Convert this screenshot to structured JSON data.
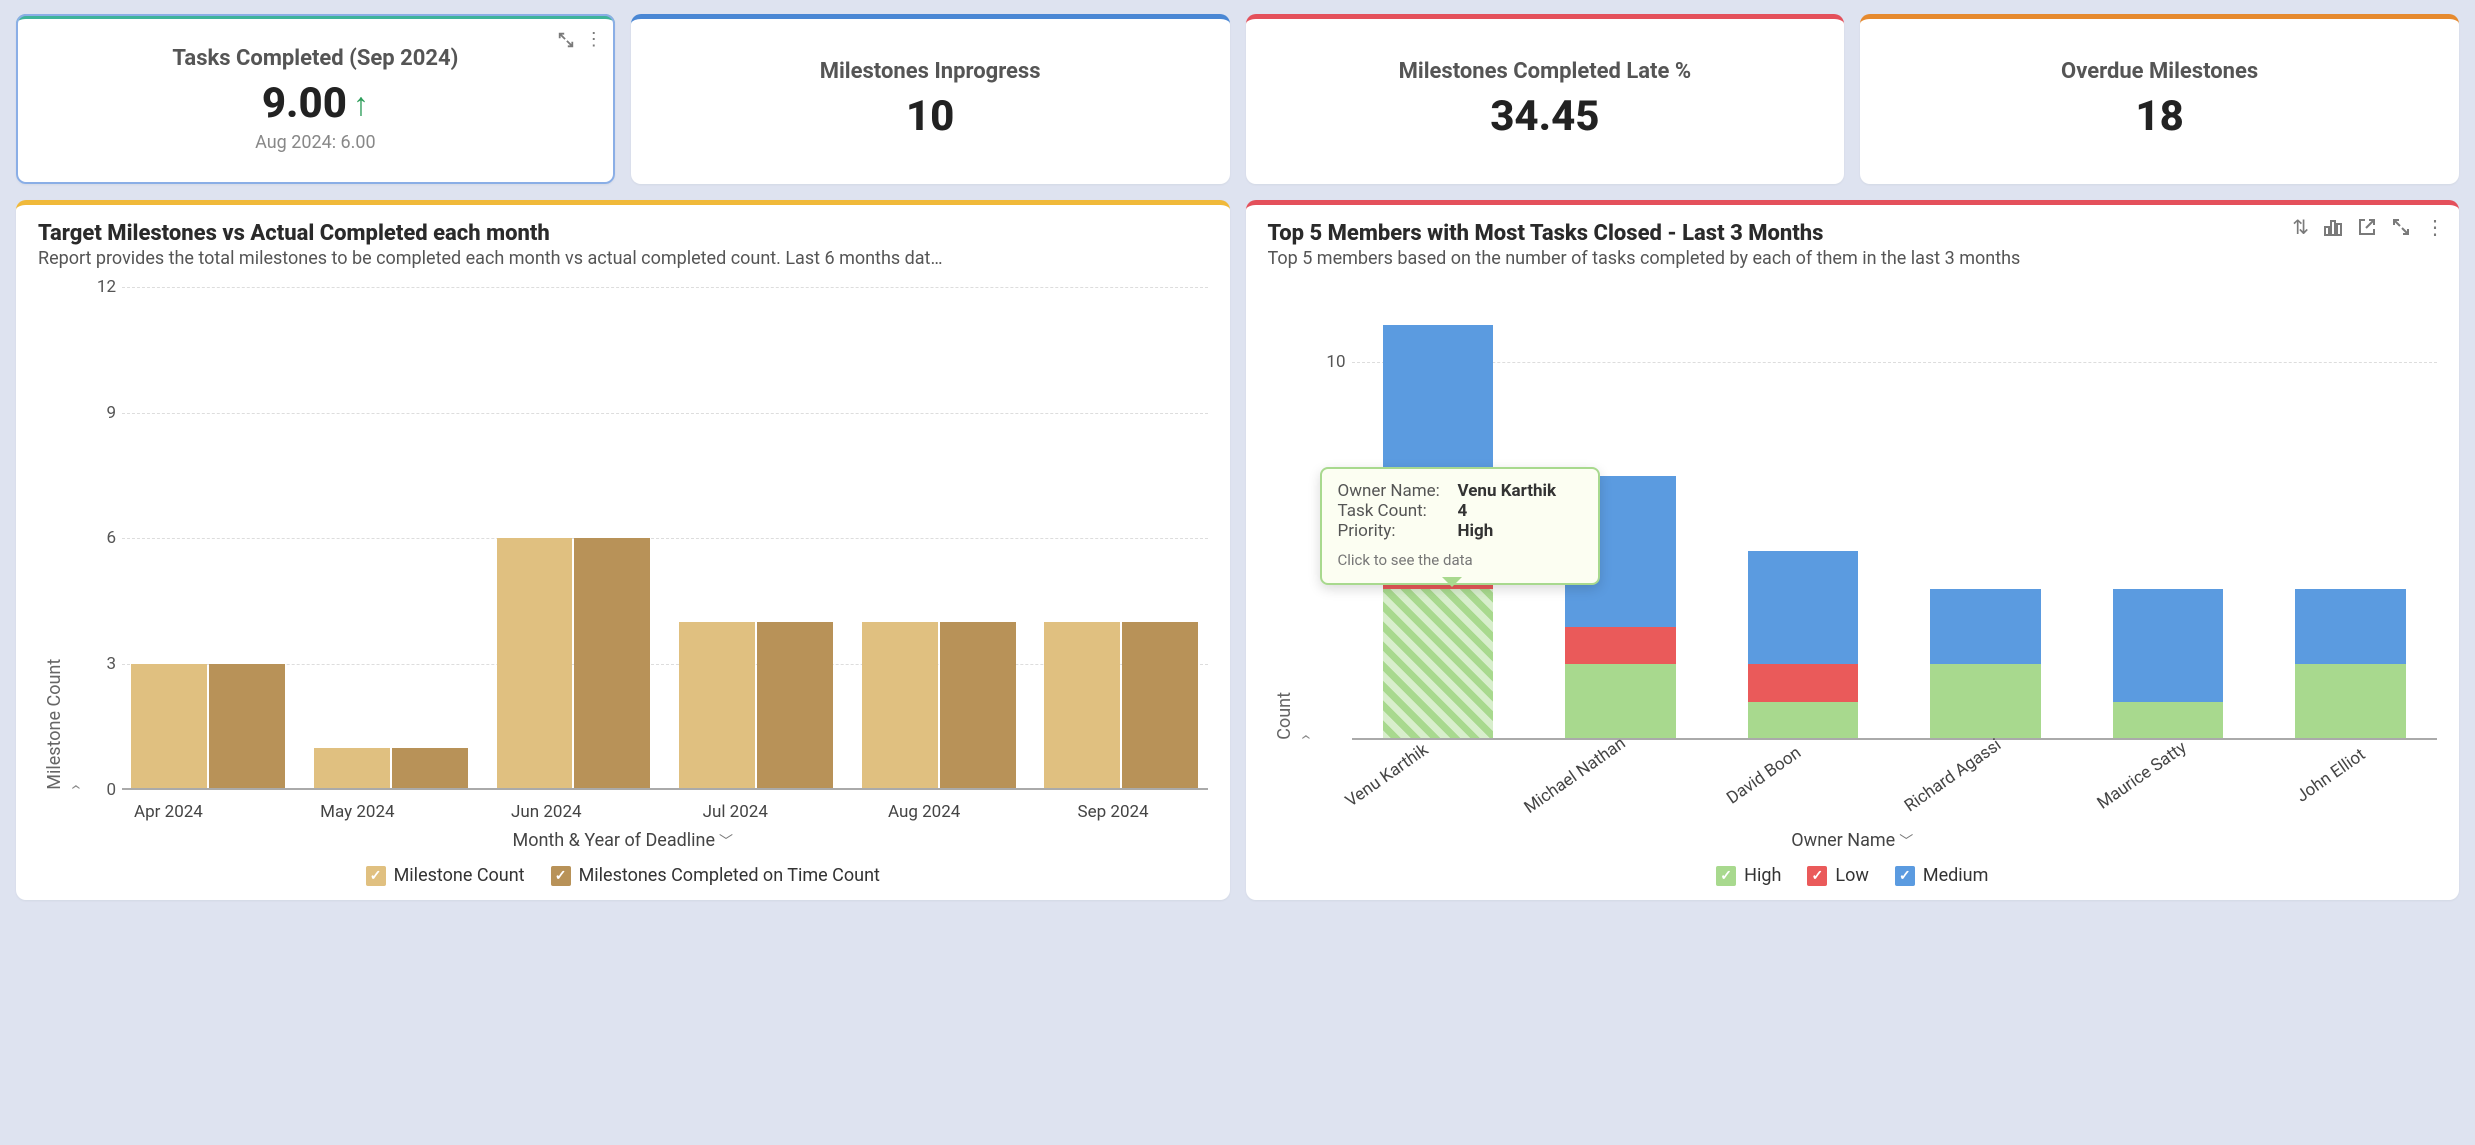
{
  "kpis": [
    {
      "title": "Tasks Completed (Sep 2024)",
      "value": "9.00",
      "trend": "up",
      "sub": "Aug 2024: 6.00",
      "accent": "#3fb39a",
      "active": true
    },
    {
      "title": "Milestones Inprogress",
      "value": "10",
      "accent": "#4a87d4"
    },
    {
      "title": "Milestones Completed Late %",
      "value": "34.45",
      "accent": "#e4505b"
    },
    {
      "title": "Overdue Milestones",
      "value": "18",
      "accent": "#e68a2e"
    }
  ],
  "chart1": {
    "accent": "#f0b93a",
    "title": "Target Milestones vs Actual Completed each month",
    "subtitle": "Report provides the total milestones to be completed each month vs actual completed count. Last 6 months dat…",
    "ylabel": "Milestone Count",
    "xlabel": "Month & Year of Deadline",
    "legend_a": "Milestone Count",
    "legend_b": "Milestones Completed on Time Count"
  },
  "chart2": {
    "accent": "#e4505b",
    "title": "Top 5 Members with Most Tasks Closed - Last 3 Months",
    "subtitle": "Top 5 members based on the number of tasks completed by each of them in the last 3 months",
    "ylabel": "Count",
    "xlabel": "Owner Name",
    "legend_high": "High",
    "legend_low": "Low",
    "legend_med": "Medium",
    "tooltip": {
      "k1": "Owner Name:",
      "v1": "Venu Karthik",
      "k2": "Task Count:",
      "v2": "4",
      "k3": "Priority:",
      "v3": "High",
      "foot": "Click to see the data"
    }
  },
  "chart_data": [
    {
      "type": "bar",
      "title": "Target Milestones vs Actual Completed each month",
      "xlabel": "Month & Year of Deadline",
      "ylabel": "Milestone Count",
      "ylim": [
        0,
        12
      ],
      "yticks": [
        0,
        3,
        6,
        9,
        12
      ],
      "categories": [
        "Apr 2024",
        "May 2024",
        "Jun 2024",
        "Jul 2024",
        "Aug 2024",
        "Sep 2024"
      ],
      "series": [
        {
          "name": "Milestone Count",
          "values": [
            3,
            1,
            6,
            4,
            4,
            4
          ],
          "color": "#e0c080"
        },
        {
          "name": "Milestones Completed on Time Count",
          "values": [
            3,
            1,
            6,
            4,
            4,
            4
          ],
          "color": "#b89258"
        }
      ],
      "legend_position": "bottom",
      "grid": true
    },
    {
      "type": "bar",
      "stacked": true,
      "title": "Top 5 Members with Most Tasks Closed - Last 3 Months",
      "xlabel": "Owner Name",
      "ylabel": "Count",
      "ylim": [
        0,
        12
      ],
      "yticks": [
        10
      ],
      "categories": [
        "Venu Karthik",
        "Michael Nathan",
        "David Boon",
        "Richard Agassi",
        "Maurice Satty",
        "John Elliot"
      ],
      "series": [
        {
          "name": "High",
          "values": [
            4,
            2,
            1,
            2,
            1,
            2
          ],
          "color": "#a8d98e"
        },
        {
          "name": "Low",
          "values": [
            1,
            1,
            1,
            0,
            0,
            0
          ],
          "color": "#ea5a5a"
        },
        {
          "name": "Medium",
          "values": [
            6,
            4,
            3,
            2,
            3,
            2
          ],
          "color": "#5b9be0"
        }
      ],
      "legend_position": "bottom",
      "grid": true,
      "highlight": {
        "category": "Venu Karthik",
        "series": "High"
      },
      "tooltip": {
        "Owner Name": "Venu Karthik",
        "Task Count": 4,
        "Priority": "High",
        "footnote": "Click to see the data"
      }
    }
  ]
}
